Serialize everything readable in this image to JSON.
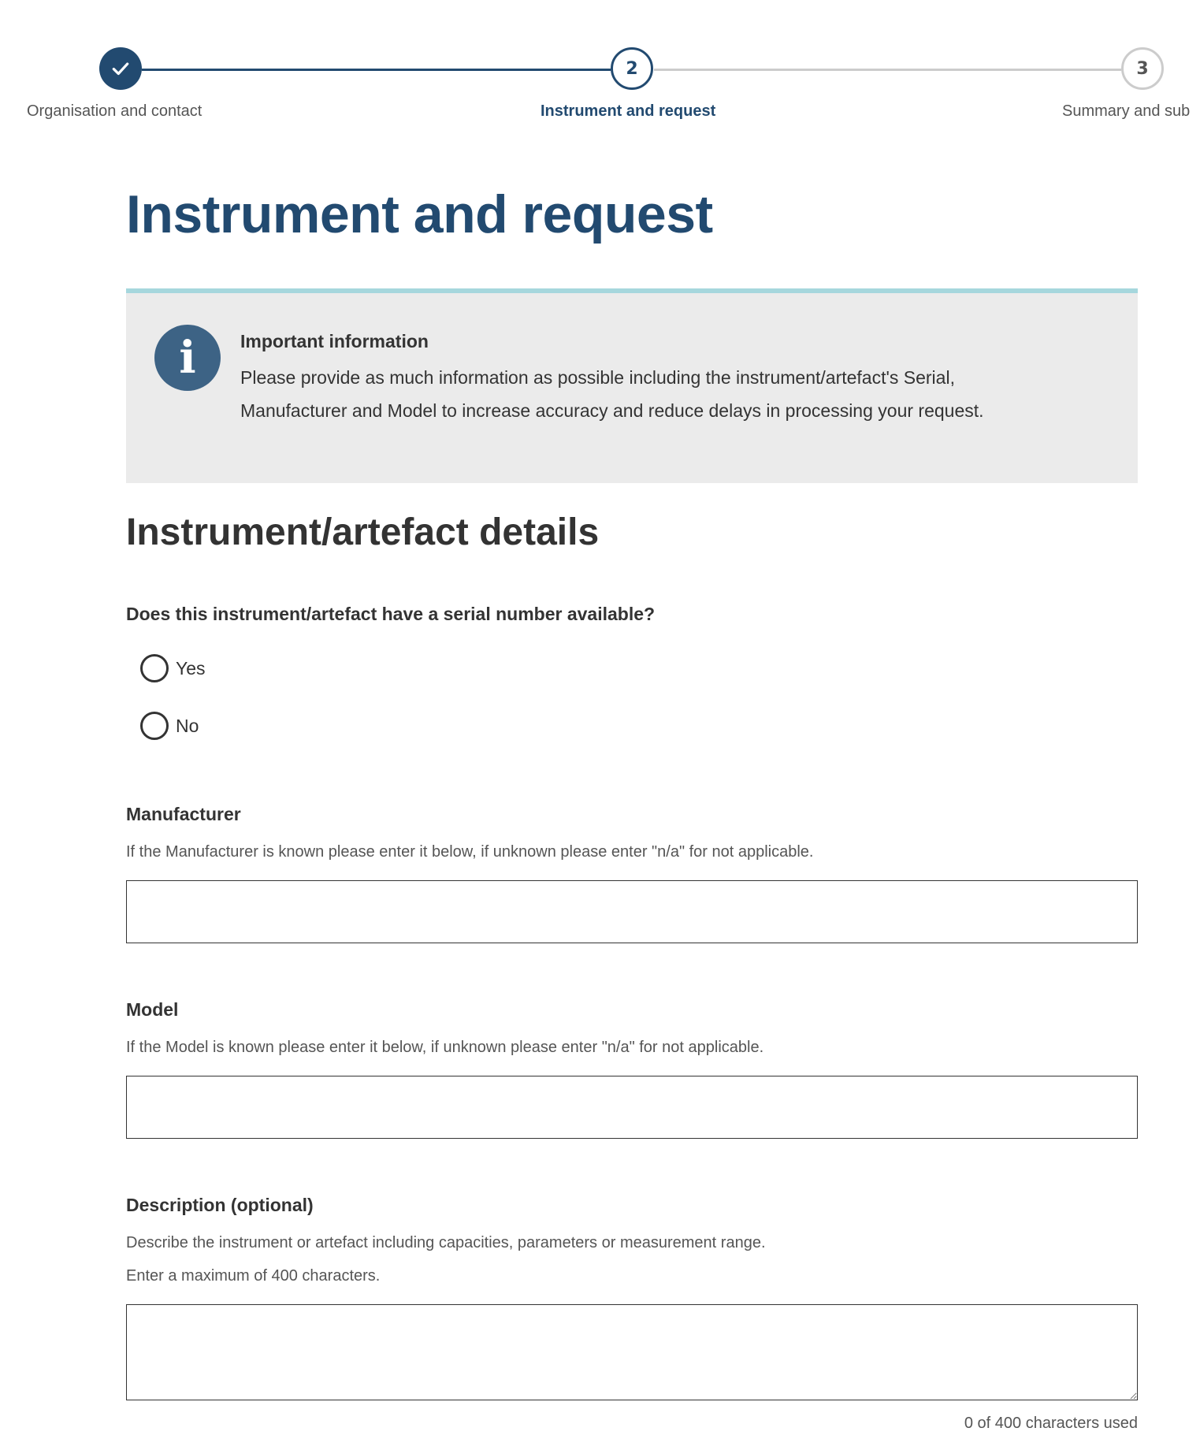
{
  "stepper": {
    "steps": [
      {
        "number": "",
        "label": "Organisation and contact",
        "status": "complete"
      },
      {
        "number": "2",
        "label": "Instrument and request",
        "status": "current"
      },
      {
        "number": "3",
        "label": "Summary and sub",
        "status": "upcoming"
      }
    ],
    "icons": {
      "complete": "check-icon"
    },
    "colors": {
      "primary": "#224a70",
      "inactive": "#cccccc"
    }
  },
  "page": {
    "title": "Instrument and request"
  },
  "callout": {
    "icon": "info-icon",
    "title": "Important information",
    "body": "Please provide as much information as possible including the instrument/artefact's Serial, Manufacturer and Model to increase accuracy and reduce delays in processing your request.",
    "colors": {
      "accent": "#a6d7dd",
      "background": "#ebebeb",
      "icon": "#3d6385"
    }
  },
  "section": {
    "heading": "Instrument/artefact details"
  },
  "serial_question": {
    "label": "Does this instrument/artefact have a serial number available?",
    "options": [
      {
        "label": "Yes",
        "selected": false
      },
      {
        "label": "No",
        "selected": false
      }
    ]
  },
  "manufacturer": {
    "label": "Manufacturer",
    "hint": "If the Manufacturer is known please enter it below, if unknown please enter \"n/a\" for not applicable.",
    "value": ""
  },
  "model": {
    "label": "Model",
    "hint": "If the Model is known please enter it below, if unknown please enter \"n/a\" for not applicable.",
    "value": ""
  },
  "description": {
    "label": "Description (optional)",
    "hint": "Describe the instrument or artefact including capacities, parameters or measurement range.",
    "hint2": "Enter a maximum of 400 characters.",
    "value": "",
    "counter": "0 of 400 characters used"
  }
}
